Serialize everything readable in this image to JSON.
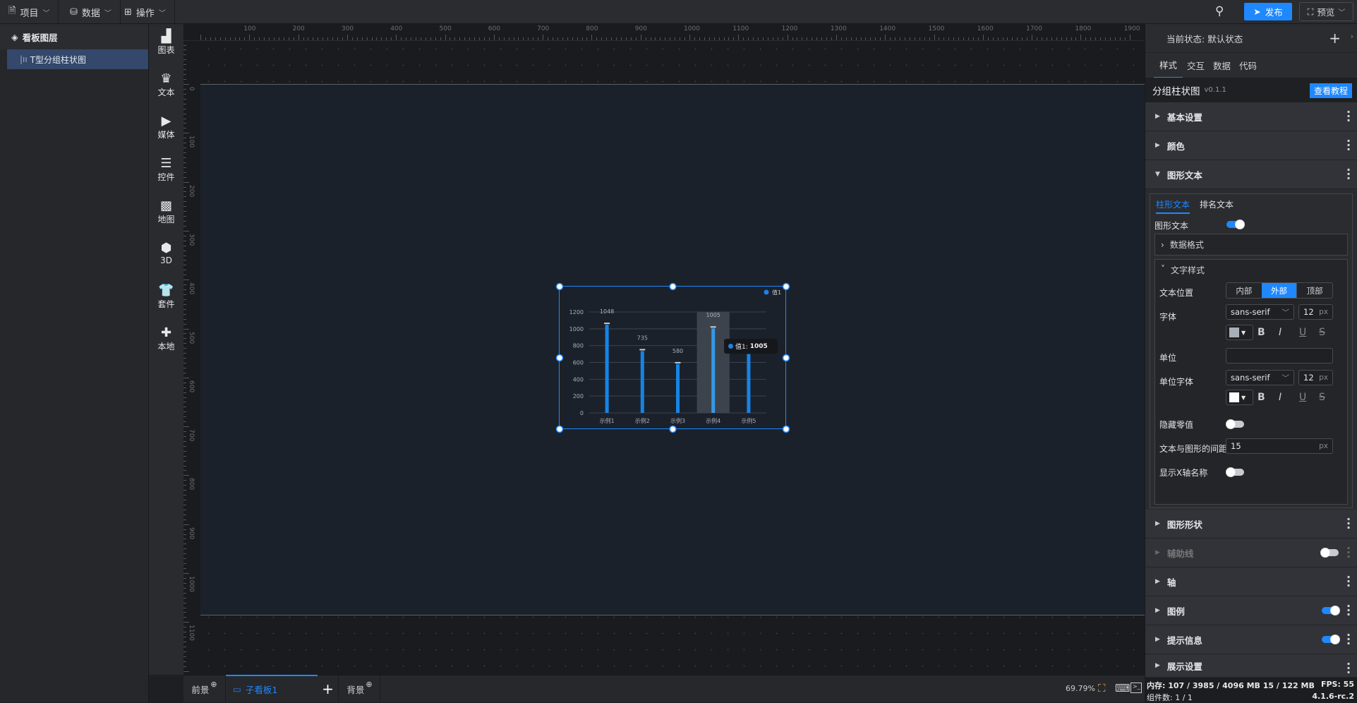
{
  "topbar": {
    "menus": [
      {
        "label": "项目",
        "icon": "document-icon"
      },
      {
        "label": "数据",
        "icon": "database-icon"
      },
      {
        "label": "操作",
        "icon": "grid-icon"
      }
    ],
    "publish": "发布",
    "preview": "预览"
  },
  "layers": {
    "title": "看板图层",
    "items": [
      {
        "label": "T型分组柱状图",
        "selected": true
      }
    ]
  },
  "toolbox": [
    {
      "label": "图表",
      "icon": "bar-chart-icon"
    },
    {
      "label": "文本",
      "icon": "crown-text-icon"
    },
    {
      "label": "媒体",
      "icon": "media-camera-icon"
    },
    {
      "label": "控件",
      "icon": "widget-list-icon"
    },
    {
      "label": "地图",
      "icon": "map-icon"
    },
    {
      "label": "3D",
      "icon": "cube-icon"
    },
    {
      "label": "套件",
      "icon": "shirt-kit-icon"
    },
    {
      "label": "本地",
      "icon": "puzzle-icon"
    }
  ],
  "ruler": {
    "h": [
      "100",
      "200",
      "300",
      "400",
      "500",
      "600",
      "700",
      "800",
      "900",
      "1000",
      "1100",
      "1200",
      "1300",
      "1400",
      "1500",
      "1600",
      "1700",
      "1800",
      "1900"
    ],
    "v": [
      "0",
      "100",
      "200",
      "300",
      "400",
      "500",
      "600",
      "700",
      "800",
      "900",
      "1000",
      "1100"
    ]
  },
  "bottom": {
    "foreground": "前景",
    "subboard": "子看板1",
    "background": "背景",
    "zoom": "69.79%"
  },
  "chart_data": {
    "type": "bar",
    "categories": [
      "示例1",
      "示例2",
      "示例3",
      "示例4",
      "示例5"
    ],
    "series": [
      {
        "name": "值1",
        "values": [
          1048,
          735,
          580,
          1005,
          700
        ]
      }
    ],
    "ylim": [
      0,
      1200
    ],
    "yticks": [
      "0",
      "200",
      "400",
      "600",
      "800",
      "1000",
      "1200"
    ],
    "legend": "top-right",
    "highlight_index": 3,
    "tooltip": {
      "label": "值1:",
      "value": "1005"
    },
    "color": "#1684e6"
  },
  "panel": {
    "state_label": "当前状态:",
    "state_value": "默认状态",
    "tabs": [
      "样式",
      "交互",
      "数据",
      "代码"
    ],
    "active_tab": 0,
    "component": "分组柱状图",
    "version": "v0.1.1",
    "tutorial": "查看教程",
    "sections_top": [
      "基本设置",
      "颜色",
      "图形文本"
    ],
    "sub_tabs": [
      "柱形文本",
      "排名文本"
    ],
    "graphic_text_label": "图形文本",
    "data_format": "数据格式",
    "text_style": "文字样式",
    "text_position_label": "文本位置",
    "positions": [
      "内部",
      "外部",
      "顶部"
    ],
    "position_active": 1,
    "font_label": "字体",
    "font": "sans-serif",
    "font_size": "12",
    "unit_px": "px",
    "font_color": "#a9aebb",
    "unit_label": "单位",
    "unit_value": "",
    "unit_font_label": "单位字体",
    "unit_font": "sans-serif",
    "unit_font_size": "12",
    "unit_font_color": "#ffffff",
    "hide_zero_label": "隐藏零值",
    "gap_label": "文本与图形的间距",
    "gap_value": "15",
    "show_x_label": "显示X轴名称",
    "sections_bottom": [
      {
        "label": "图形形状"
      },
      {
        "label": "辅助线",
        "toggle": false,
        "disabled": true
      },
      {
        "label": "轴"
      },
      {
        "label": "图例",
        "toggle": true
      },
      {
        "label": "提示信息",
        "toggle": true
      },
      {
        "label": "展示设置"
      }
    ]
  },
  "status": {
    "memory": "内存:  107 / 3985 / 4096 MB  15 / 122 MB",
    "fps": "FPS:  55",
    "components": "组件数: 1 / 1",
    "version": "4.1.6-rc.2"
  }
}
